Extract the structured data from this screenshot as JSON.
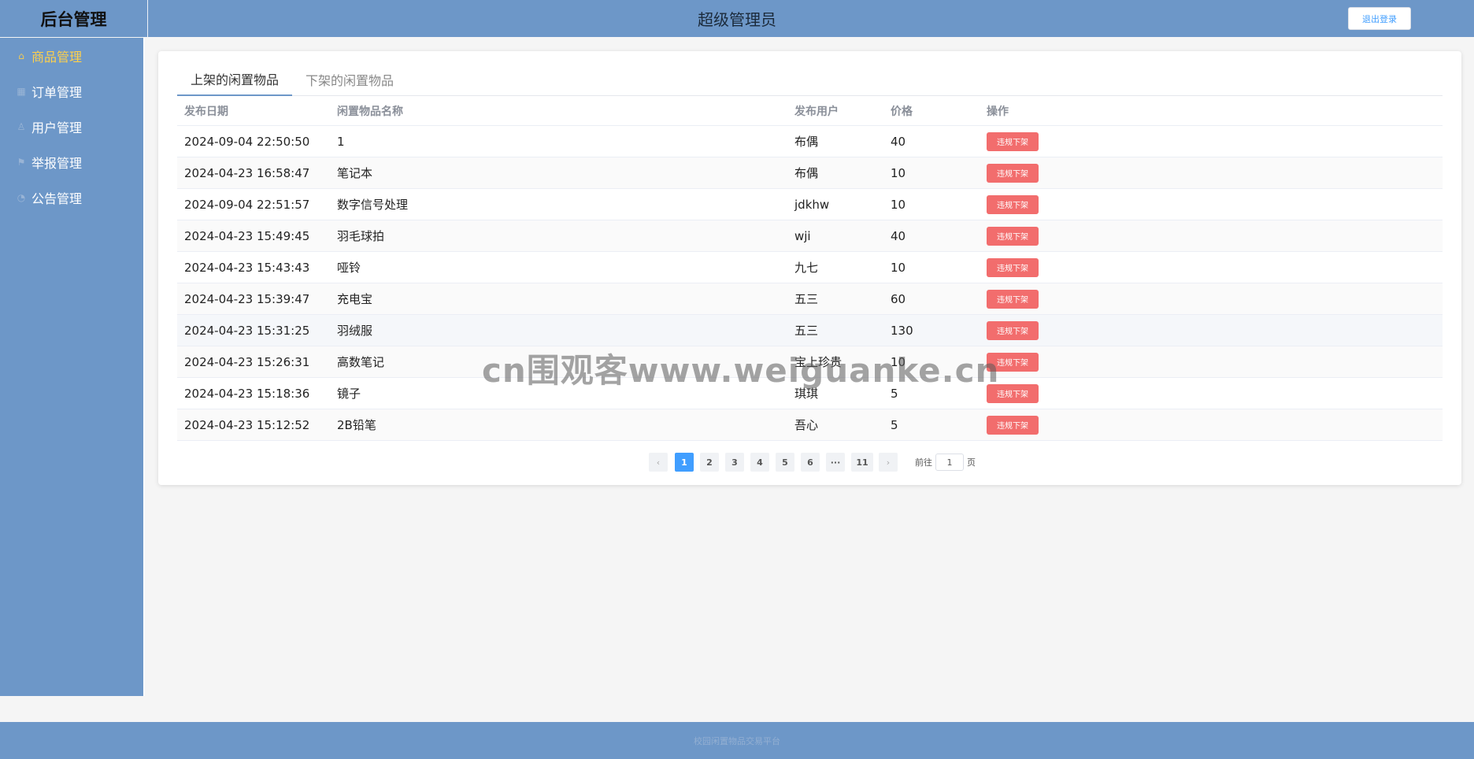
{
  "header": {
    "brand": "后台管理",
    "title": "超级管理员",
    "logout_label": "退出登录"
  },
  "sidebar": {
    "items": [
      {
        "label": "商品管理",
        "icon": "home-icon",
        "active": true
      },
      {
        "label": "订单管理",
        "icon": "grid-icon",
        "active": false
      },
      {
        "label": "用户管理",
        "icon": "user-icon",
        "active": false
      },
      {
        "label": "举报管理",
        "icon": "flag-icon",
        "active": false
      },
      {
        "label": "公告管理",
        "icon": "bell-icon",
        "active": false
      }
    ]
  },
  "tabs": [
    {
      "label": "上架的闲置物品",
      "active": true
    },
    {
      "label": "下架的闲置物品",
      "active": false
    }
  ],
  "table": {
    "headers": [
      "发布日期",
      "闲置物品名称",
      "发布用户",
      "价格",
      "操作"
    ],
    "rows": [
      {
        "date": "2024-09-04 22:50:50",
        "name": "1",
        "user": "布偶",
        "price": "40",
        "action": "违规下架"
      },
      {
        "date": "2024-04-23 16:58:47",
        "name": "笔记本",
        "user": "布偶",
        "price": "10",
        "action": "违规下架"
      },
      {
        "date": "2024-09-04 22:51:57",
        "name": "数字信号处理",
        "user": "jdkhw",
        "price": "10",
        "action": "违规下架"
      },
      {
        "date": "2024-04-23 15:49:45",
        "name": "羽毛球拍",
        "user": "wji",
        "price": "40",
        "action": "违规下架"
      },
      {
        "date": "2024-04-23 15:43:43",
        "name": "哑铃",
        "user": "九七",
        "price": "10",
        "action": "违规下架"
      },
      {
        "date": "2024-04-23 15:39:47",
        "name": "充电宝",
        "user": "五三",
        "price": "60",
        "action": "违规下架"
      },
      {
        "date": "2024-04-23 15:31:25",
        "name": "羽绒服",
        "user": "五三",
        "price": "130",
        "action": "违规下架"
      },
      {
        "date": "2024-04-23 15:26:31",
        "name": "高数笔记",
        "user": "宝上珍贵",
        "price": "10",
        "action": "违规下架"
      },
      {
        "date": "2024-04-23 15:18:36",
        "name": "镜子",
        "user": "琪琪",
        "price": "5",
        "action": "违规下架"
      },
      {
        "date": "2024-04-23 15:12:52",
        "name": "2B铅笔",
        "user": "吾心",
        "price": "5",
        "action": "违规下架"
      }
    ]
  },
  "pagination": {
    "prev": "‹",
    "next": "›",
    "pages": [
      "1",
      "2",
      "3",
      "4",
      "5",
      "6",
      "···",
      "11"
    ],
    "current": "1",
    "goto_prefix": "前往",
    "goto_value": "1",
    "goto_suffix": "页"
  },
  "watermark": "cn围观客www.weiguanke.cn",
  "footer": "校园闲置物品交易平台"
}
